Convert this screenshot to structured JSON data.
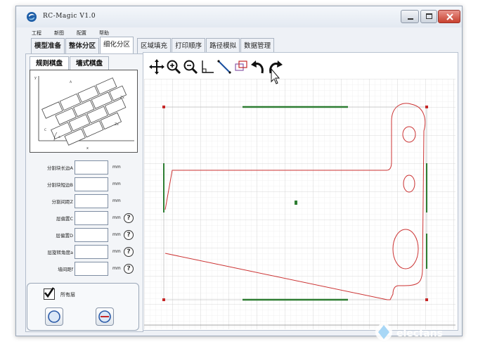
{
  "window": {
    "title": "RC-Magic V1.0"
  },
  "menu": [
    "工程",
    "新图",
    "配置",
    "帮助"
  ],
  "tabs": [
    "模型准备",
    "整体分区",
    "细化分区",
    "区域填充",
    "打印顺序",
    "路径模拟",
    "数据管理"
  ],
  "subtabs": [
    "规则棋盘",
    "墙式棋盘"
  ],
  "params": [
    {
      "label": "分割块长边A",
      "value": "",
      "unit": "mm",
      "help": false
    },
    {
      "label": "分割块短边B",
      "value": "",
      "unit": "mm",
      "help": false
    },
    {
      "label": "分割间距Z",
      "value": "",
      "unit": "mm",
      "help": false
    },
    {
      "label": "层偏置C",
      "value": "",
      "unit": "mm",
      "help": true
    },
    {
      "label": "层偏置D",
      "value": "",
      "unit": "mm",
      "help": true
    },
    {
      "label": "层旋转角度a",
      "value": "",
      "unit": "mm",
      "help": true
    },
    {
      "label": "墙间距f",
      "value": "",
      "unit": "mm",
      "help": true
    }
  ],
  "all_layers": {
    "label": "所有层",
    "checked": true
  },
  "toolbar": [
    "pan-icon",
    "zoom-in-icon",
    "zoom-out-icon",
    "axis-icon",
    "line-icon",
    "region-icon",
    "undo-icon",
    "redo-icon"
  ],
  "colors": {
    "outline": "#cc3333",
    "border_line": "#2e7d32",
    "grid": "#d9d9d9"
  },
  "watermark": "elecfans"
}
